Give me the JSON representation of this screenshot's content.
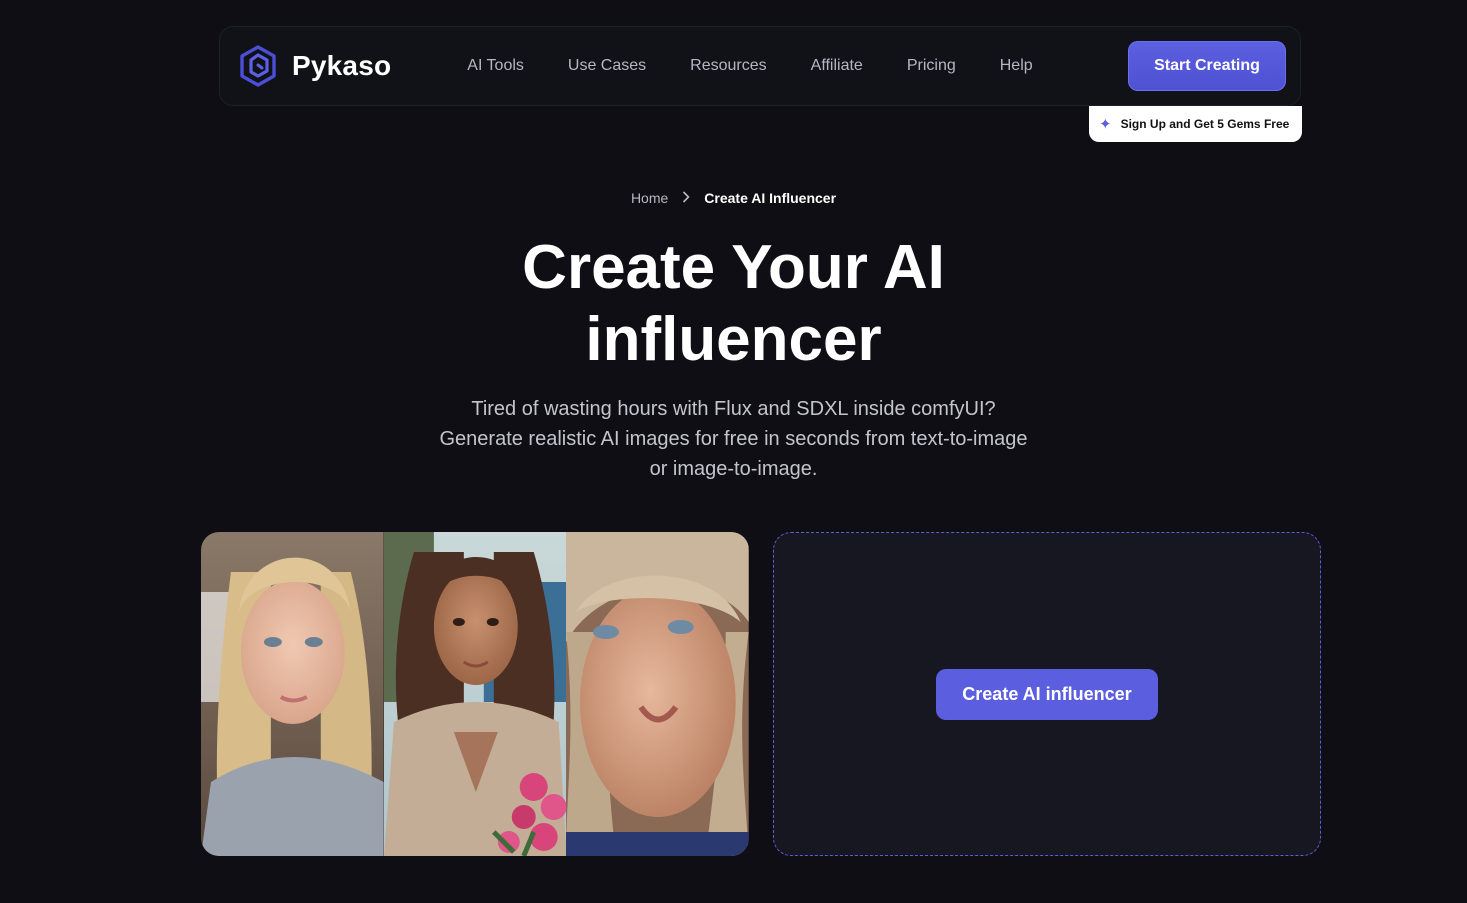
{
  "brand": {
    "name": "Pykaso",
    "accent": "#5b5fdf",
    "logo_icon": "hexagon-logo-icon"
  },
  "nav": {
    "links": [
      "AI Tools",
      "Use Cases",
      "Resources",
      "Affiliate",
      "Pricing",
      "Help"
    ],
    "cta_label": "Start Creating"
  },
  "promo": {
    "icon": "sparkle-icon",
    "label": "Sign Up and Get 5 Gems Free"
  },
  "breadcrumb": {
    "home": "Home",
    "separator_icon": "chevron-right-icon",
    "current": "Create AI Influencer"
  },
  "hero": {
    "title_line1": "Create Your AI",
    "title_line2": "influencer",
    "subtitle_line1": "Tired of wasting hours with Flux and SDXL inside comfyUI?",
    "subtitle_line2": "Generate realistic AI images for free in seconds from text-to-image",
    "subtitle_line3": "or image-to-image."
  },
  "gallery": {
    "photo_count": 3
  },
  "dropzone": {
    "button_label": "Create AI influencer"
  }
}
